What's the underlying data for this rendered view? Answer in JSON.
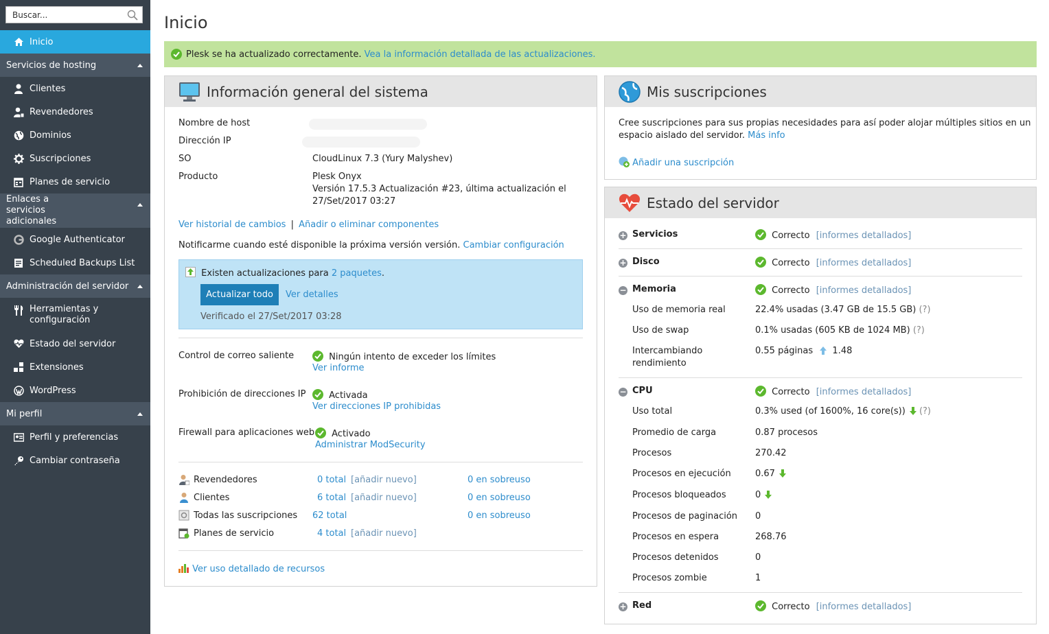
{
  "sidebar": {
    "search_placeholder": "Buscar...",
    "items": {
      "inicio": "Inicio",
      "clientes": "Clientes",
      "revendedores": "Revendedores",
      "dominios": "Dominios",
      "suscripciones": "Suscripciones",
      "planes": "Planes de servicio",
      "google_auth": "Google Authenticator",
      "backups": "Scheduled Backups List",
      "herramientas": "Herramientas y configuración",
      "estado": "Estado del servidor",
      "extensiones": "Extensiones",
      "wordpress": "WordPress",
      "perfil": "Perfil y preferencias",
      "contrasena": "Cambiar contraseña"
    },
    "groups": {
      "hosting": "Servicios de hosting",
      "enlaces": "Enlaces a servicios adicionales",
      "admin": "Administración del servidor",
      "miperfil": "Mi perfil"
    }
  },
  "page": {
    "title": "Inicio",
    "alert_text": "Plesk se ha actualizado correctamente.",
    "alert_link": "Vea la información detallada de las actualizaciones."
  },
  "system_info": {
    "title": "Información general del sistema",
    "host_label": "Nombre de host",
    "ip_label": "Dirección IP",
    "os_label": "SO",
    "os_value": "CloudLinux 7.3 (Yury Malyshev)",
    "product_label": "Producto",
    "product_line1": "Plesk Onyx",
    "product_line2": "Versión 17.5.3 Actualización #23, última actualización el",
    "product_line3": "27/Set/2017 03:27",
    "history_link": "Ver historial de cambios",
    "separator": "|",
    "components_link": "Añadir o eliminar componentes",
    "notify_text": "Notificarme cuando esté disponible la próxima versión versión.",
    "notify_link": "Cambiar configuración",
    "updates_text": "Existen actualizaciones para",
    "updates_link": "2 paquetes",
    "updates_dot": ".",
    "update_all_button": "Actualizar todo",
    "details_link": "Ver detalles",
    "verified": "Verificado el 27/Set/2017 03:28",
    "mail_label": "Control de correo saliente",
    "mail_status": "Ningún intento de exceder los límites",
    "mail_link": "Ver informe",
    "ipban_label": "Prohibición de direcciones IP",
    "ipban_status": "Activada",
    "ipban_link": "Ver direcciones IP prohibidas",
    "waf_label": "Firewall para aplicaciones web",
    "waf_status": "Activado",
    "waf_link": "Administrar ModSecurity",
    "stats": [
      {
        "label": "Revendedores",
        "total": "0 total",
        "add": "[añadir nuevo]",
        "over": "0 en sobreuso"
      },
      {
        "label": "Clientes",
        "total": "6 total",
        "add": "[añadir nuevo]",
        "over": "0 en sobreuso"
      },
      {
        "label": "Todas las suscripciones",
        "total": "62 total",
        "add": "",
        "over": "0 en sobreuso"
      },
      {
        "label": "Planes de servicio",
        "total": "4 total",
        "add": "[añadir nuevo]",
        "over": ""
      }
    ],
    "usage_link": "Ver uso detallado de recursos"
  },
  "subscriptions": {
    "title": "Mis suscripciones",
    "text_line1": "Cree suscripciones para sus propias necesidades para así poder alojar múltiples sitios en un",
    "text_line2": "espacio aislado del servidor.",
    "more_link": "Más info",
    "add_link": "Añadir una suscripción"
  },
  "server_status": {
    "title": "Estado del servidor",
    "ok": "Correcto",
    "reports": "[informes detallados]",
    "services": "Servicios",
    "disk": "Disco",
    "memory": "Memoria",
    "mem_real_label": "Uso de memoria real",
    "mem_real_value": "22.4% usadas (3.47 GB de 15.5 GB)",
    "swap_label": "Uso de swap",
    "swap_value": "0.1% usadas (605 KB de 1024 MB)",
    "paging_label_1": "Intercambiando",
    "paging_label_2": "rendimiento",
    "paging_value": "0.55 páginas",
    "paging_value2": "1.48",
    "help": "(?)",
    "cpu": "CPU",
    "cpu_rows": [
      {
        "label": "Uso total",
        "value": "0.3% used (of 1600%, 16 core(s))"
      },
      {
        "label": "Promedio de carga",
        "value": "0.87 procesos"
      },
      {
        "label": "Procesos",
        "value": "270.42"
      },
      {
        "label": "Procesos en ejecución",
        "value": "0.67"
      },
      {
        "label": "Procesos bloqueados",
        "value": "0"
      },
      {
        "label": "Procesos de paginación",
        "value": "0"
      },
      {
        "label": "Procesos en espera",
        "value": "268.76"
      },
      {
        "label": "Procesos detenidos",
        "value": "0"
      },
      {
        "label": "Procesos zombie",
        "value": "1"
      }
    ],
    "network": "Red"
  },
  "colors": {
    "sidebar_bg": "#37414b",
    "sidebar_group": "#4a5663",
    "active": "#29a8de",
    "alert": "#c1e39d",
    "link": "#2c8ccc",
    "ok_green": "#5cb82e"
  }
}
